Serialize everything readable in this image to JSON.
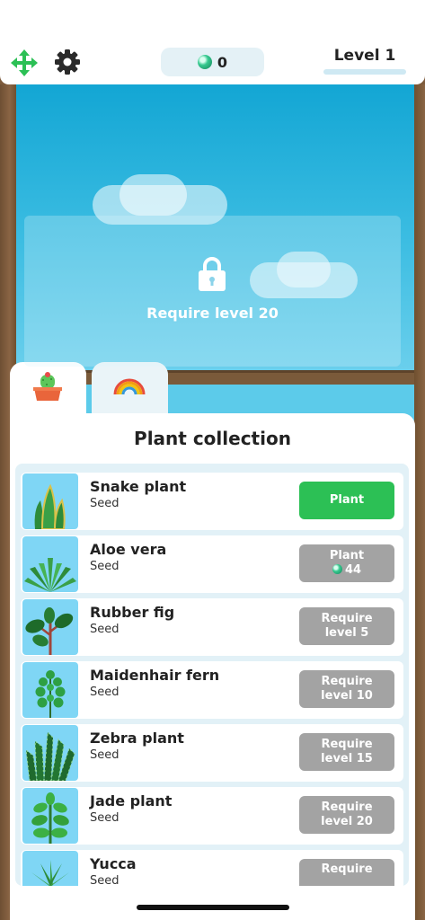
{
  "header": {
    "gems": "0",
    "level": "Level 1"
  },
  "scene": {
    "lock_text": "Require level 20"
  },
  "tabs": [
    {
      "name": "plants",
      "icon": "cactus-pot-icon",
      "active": true
    },
    {
      "name": "decorations",
      "icon": "rainbow-icon",
      "active": false
    }
  ],
  "panel": {
    "title": "Plant collection",
    "plants": [
      {
        "name": "Snake plant",
        "stage": "Seed",
        "action": "Plant",
        "cost": "",
        "state": "available"
      },
      {
        "name": "Aloe vera",
        "stage": "Seed",
        "action": "Plant",
        "cost": "44",
        "state": "cost"
      },
      {
        "name": "Rubber fig",
        "stage": "Seed",
        "action": "Require level 5",
        "cost": "",
        "state": "locked"
      },
      {
        "name": "Maidenhair fern",
        "stage": "Seed",
        "action": "Require level 10",
        "cost": "",
        "state": "locked"
      },
      {
        "name": "Zebra plant",
        "stage": "Seed",
        "action": "Require level 15",
        "cost": "",
        "state": "locked"
      },
      {
        "name": "Jade plant",
        "stage": "Seed",
        "action": "Require level 20",
        "cost": "",
        "state": "locked"
      },
      {
        "name": "Yucca",
        "stage": "Seed",
        "action": "Require",
        "cost": "",
        "state": "locked"
      }
    ]
  },
  "colors": {
    "accent_green": "#2cc055",
    "locked_grey": "#a3a3a3",
    "sky": "#13a6d4",
    "wood": "#7d5b3c"
  }
}
